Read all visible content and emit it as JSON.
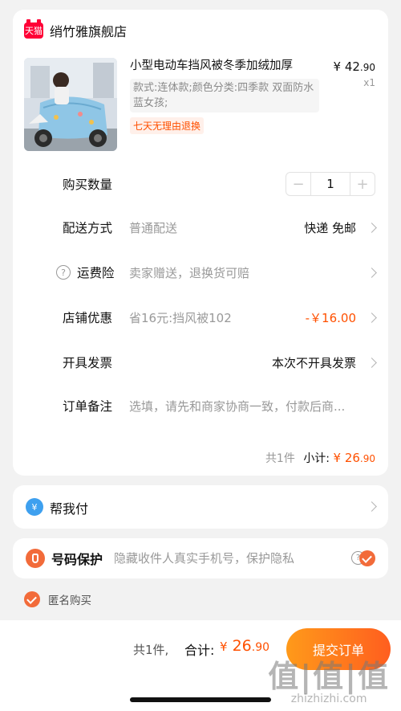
{
  "store": {
    "logo_text": "天猫",
    "name": "绡竹雅旗舰店"
  },
  "product": {
    "title": "小型电动车挡风被冬季加绒加厚",
    "spec": "款式:连体款;颜色分类:四季款 双面防水 蓝女孩;",
    "return_tag": "七天无理由退换",
    "price_symbol": "¥",
    "price_int": "42",
    "price_dec": ".90",
    "qty_label": "x1"
  },
  "rows": {
    "quantity": {
      "label": "购买数量",
      "value": "1",
      "minus": "−",
      "plus": "+"
    },
    "delivery": {
      "label": "配送方式",
      "value": "普通配送",
      "right": "快递 免邮"
    },
    "insurance": {
      "label": "运费险",
      "value": "卖家赠送，退换货可赔",
      "help": "?"
    },
    "discount": {
      "label": "店铺优惠",
      "value": "省16元:挡风被102",
      "right": "-￥16.00"
    },
    "invoice": {
      "label": "开具发票",
      "right": "本次不开具发票"
    },
    "remark": {
      "label": "订单备注",
      "placeholder": "选填，请先和商家协商一致，付款后商..."
    }
  },
  "subtotal": {
    "count": "共1件",
    "label": "小计:",
    "symbol": "¥",
    "int": "26",
    "dec": ".90"
  },
  "pay_for_me": {
    "icon": "¥",
    "label": "帮我付"
  },
  "number_protect": {
    "label": "号码保护",
    "desc": "隐藏收件人真实手机号，保护隐私",
    "help": "?"
  },
  "anonymous": {
    "label": "匿名购买"
  },
  "bottom": {
    "count": "共1件,",
    "total_label": "合计:",
    "symbol": "¥",
    "int": "26",
    "dec": ".90",
    "submit": "提交订单"
  },
  "watermark": {
    "big": "值|值|值",
    "small": "zhizhizhi.com"
  },
  "colors": {
    "accent": "#ff5000",
    "checkbox": "#f26b3a",
    "tmall": "#ff0036",
    "pay_blue": "#3ea0ef"
  }
}
